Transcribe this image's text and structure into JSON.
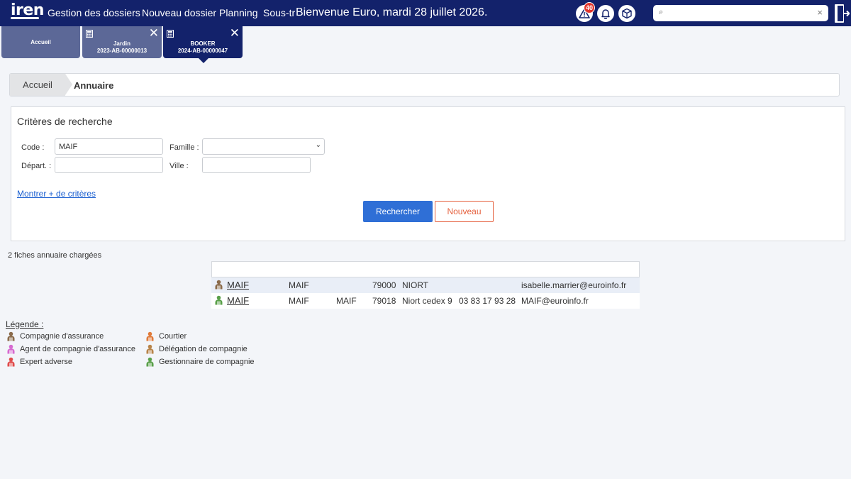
{
  "topbar": {
    "logo": "iren",
    "nav": [
      "Gestion des dossiers",
      "Nouveau dossier",
      "Planning",
      "Sous-tr"
    ],
    "welcome": "Bienvenue Euro, mardi 28 juillet 2026.",
    "alert_count": "40",
    "search_value": "",
    "colors": {
      "bar": "#13226b",
      "badge": "#e2362d"
    },
    "icons": [
      "warning-icon",
      "bell-icon",
      "package-icon",
      "search-icon",
      "clear-icon",
      "logout-icon"
    ]
  },
  "tabs": [
    {
      "title": "Accueil",
      "ref": ""
    },
    {
      "title": "Jardin",
      "ref": "2023-AB-00000013"
    },
    {
      "title": "BOOKER",
      "ref": "2024-AB-00000047"
    }
  ],
  "breadcrumb": {
    "home": "Accueil",
    "current": "Annuaire"
  },
  "criteria": {
    "title": "Critères de recherche",
    "code_label": "Code :",
    "code_value": "MAIF",
    "famille_label": "Famille :",
    "famille_value": "",
    "depart_label": "Départ. :",
    "depart_value": "",
    "ville_label": "Ville :",
    "ville_value": "",
    "more_link": "Montrer + de critères",
    "search_button": "Rechercher",
    "new_button": "Nouveau",
    "colors": {
      "primary": "#2f6fd6",
      "secondary": "#e5603d"
    }
  },
  "status": "2 fiches annuaire chargées",
  "results": [
    {
      "type": "compagnie-assurance",
      "name": "MAIF",
      "code": "MAIF",
      "short": "",
      "cp": "79000",
      "city": "NIORT",
      "phone": "",
      "email": "isabelle.marrier@euroinfo.fr"
    },
    {
      "type": "gestionnaire-compagnie",
      "name": "MAIF",
      "code": "MAIF",
      "short": "MAIF",
      "cp": "79018",
      "city": "Niort cedex 9",
      "phone": "03 83 17 93 28",
      "email": "MAIF@euroinfo.fr"
    }
  ],
  "legend": {
    "title": "Légende :",
    "items": [
      {
        "label": "Compagnie d'assurance",
        "color": "#8a6a4a"
      },
      {
        "label": "Agent de compagnie d'assurance",
        "color": "#d66ad0"
      },
      {
        "label": "Expert adverse",
        "color": "#e04b4b"
      },
      {
        "label": "Courtier",
        "color": "#e07a3a"
      },
      {
        "label": "Délégation de compagnie",
        "color": "#b8844a"
      },
      {
        "label": "Gestionnaire de compagnie",
        "color": "#5aa04a"
      }
    ]
  }
}
